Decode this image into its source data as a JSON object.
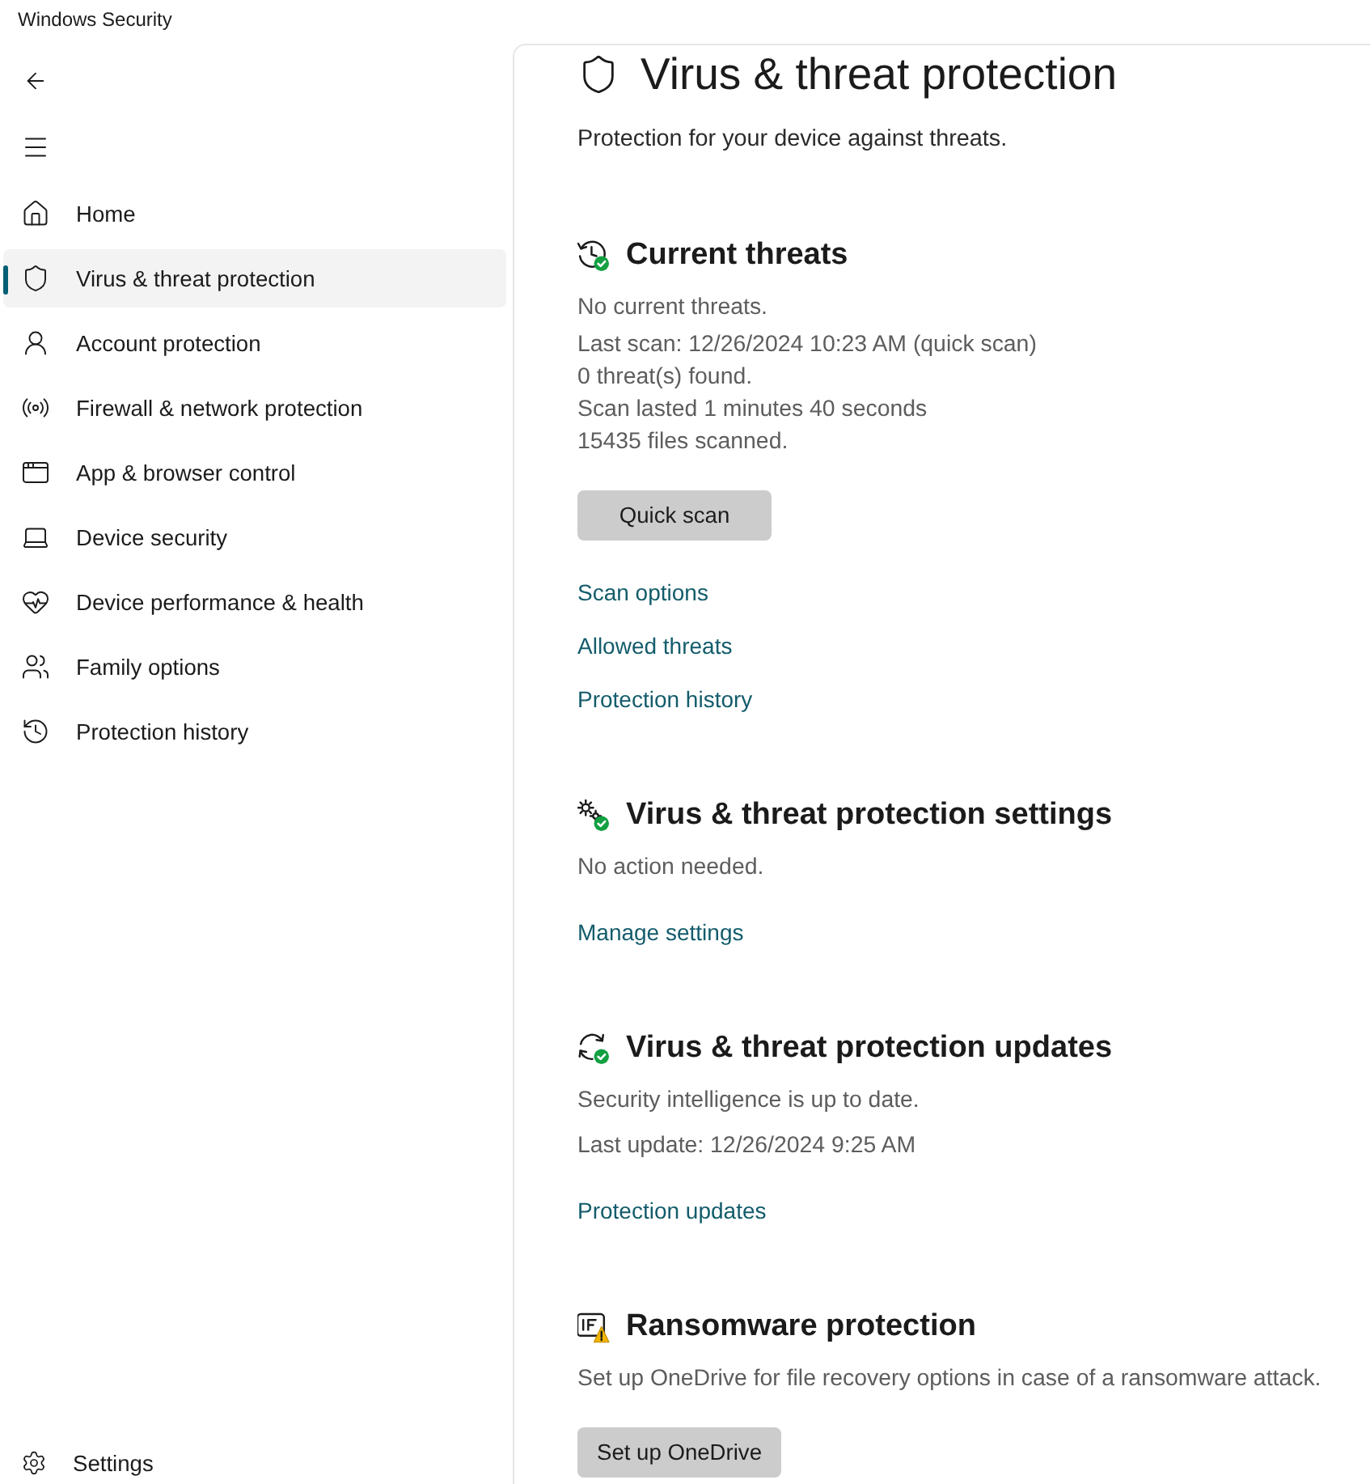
{
  "window": {
    "title": "Windows Security"
  },
  "sidebar": {
    "items": [
      {
        "label": "Home",
        "selected": false
      },
      {
        "label": "Virus & threat protection",
        "selected": true
      },
      {
        "label": "Account protection",
        "selected": false
      },
      {
        "label": "Firewall & network protection",
        "selected": false
      },
      {
        "label": "App & browser control",
        "selected": false
      },
      {
        "label": "Device security",
        "selected": false
      },
      {
        "label": "Device performance & health",
        "selected": false
      },
      {
        "label": "Family options",
        "selected": false
      },
      {
        "label": "Protection history",
        "selected": false
      }
    ],
    "settings": {
      "label": "Settings"
    }
  },
  "page": {
    "title": "Virus & threat protection",
    "subtitle": "Protection for your device against threats."
  },
  "sections": [
    {
      "title": "Current threats",
      "ok": true,
      "lines": [
        "No current threats."
      ],
      "details": [
        "Last scan: 12/26/2024 10:23 AM (quick scan)",
        "0 threat(s) found.",
        "Scan lasted 1 minutes 40 seconds",
        "15435 files scanned."
      ],
      "button": "Quick scan",
      "links": [
        "Scan options",
        "Allowed threats",
        "Protection history"
      ]
    },
    {
      "title": "Virus & threat protection settings",
      "ok": true,
      "lines": [
        "No action needed."
      ],
      "links": [
        "Manage settings"
      ]
    },
    {
      "title": "Virus & threat protection updates",
      "ok": true,
      "lines": [
        "Security intelligence is up to date.",
        "Last update: 12/26/2024 9:25 AM"
      ],
      "links": [
        "Protection updates"
      ]
    },
    {
      "title": "Ransomware protection",
      "ok": false,
      "lines": [
        "Set up OneDrive for file recovery options in case of a ransomware attack."
      ],
      "button": "Set up OneDrive"
    }
  ]
}
